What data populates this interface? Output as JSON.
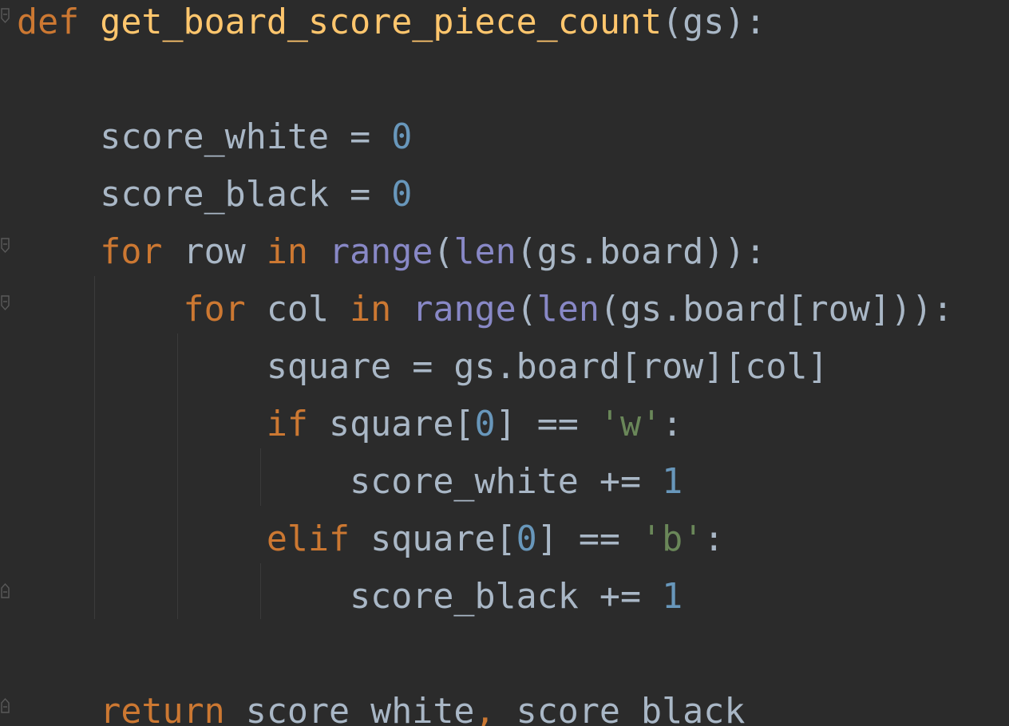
{
  "editor": {
    "background": "#2b2b2b",
    "colors": {
      "keyword": "#cc7832",
      "function_name": "#ffc66d",
      "builtin": "#8888c6",
      "number": "#6897bb",
      "string": "#6a8759",
      "identifier": "#a9b7c6"
    },
    "lines": [
      {
        "indent": "",
        "tokens": [
          {
            "t": "def",
            "c": "kw"
          },
          {
            "t": " ",
            "c": "plain"
          },
          {
            "t": "get_board_score_piece_count",
            "c": "fn"
          },
          {
            "t": "(gs):",
            "c": "punct"
          }
        ]
      },
      {
        "indent": "",
        "tokens": []
      },
      {
        "indent": "    ",
        "tokens": [
          {
            "t": "score_white",
            "c": "plain"
          },
          {
            "t": " = ",
            "c": "punct"
          },
          {
            "t": "0",
            "c": "num"
          }
        ]
      },
      {
        "indent": "    ",
        "tokens": [
          {
            "t": "score_black",
            "c": "plain"
          },
          {
            "t": " = ",
            "c": "punct"
          },
          {
            "t": "0",
            "c": "num"
          }
        ]
      },
      {
        "indent": "    ",
        "tokens": [
          {
            "t": "for",
            "c": "kw"
          },
          {
            "t": " row ",
            "c": "plain"
          },
          {
            "t": "in",
            "c": "kw"
          },
          {
            "t": " ",
            "c": "plain"
          },
          {
            "t": "range",
            "c": "bi"
          },
          {
            "t": "(",
            "c": "punct"
          },
          {
            "t": "len",
            "c": "bi"
          },
          {
            "t": "(gs.board)):",
            "c": "punct"
          }
        ]
      },
      {
        "indent": "        ",
        "tokens": [
          {
            "t": "for",
            "c": "kw"
          },
          {
            "t": " col ",
            "c": "plain"
          },
          {
            "t": "in",
            "c": "kw"
          },
          {
            "t": " ",
            "c": "plain"
          },
          {
            "t": "range",
            "c": "bi"
          },
          {
            "t": "(",
            "c": "punct"
          },
          {
            "t": "len",
            "c": "bi"
          },
          {
            "t": "(gs.board[row])):",
            "c": "punct"
          }
        ]
      },
      {
        "indent": "            ",
        "tokens": [
          {
            "t": "square = gs.board[row][col]",
            "c": "plain"
          }
        ]
      },
      {
        "indent": "            ",
        "tokens": [
          {
            "t": "if",
            "c": "kw"
          },
          {
            "t": " square[",
            "c": "plain"
          },
          {
            "t": "0",
            "c": "num"
          },
          {
            "t": "] == ",
            "c": "plain"
          },
          {
            "t": "'w'",
            "c": "str"
          },
          {
            "t": ":",
            "c": "punct"
          }
        ]
      },
      {
        "indent": "                ",
        "tokens": [
          {
            "t": "score_white += ",
            "c": "plain"
          },
          {
            "t": "1",
            "c": "num"
          }
        ]
      },
      {
        "indent": "            ",
        "tokens": [
          {
            "t": "elif",
            "c": "kw"
          },
          {
            "t": " square[",
            "c": "plain"
          },
          {
            "t": "0",
            "c": "num"
          },
          {
            "t": "] == ",
            "c": "plain"
          },
          {
            "t": "'b'",
            "c": "str"
          },
          {
            "t": ":",
            "c": "punct"
          }
        ]
      },
      {
        "indent": "                ",
        "tokens": [
          {
            "t": "score_black += ",
            "c": "plain"
          },
          {
            "t": "1",
            "c": "num"
          }
        ]
      },
      {
        "indent": "",
        "tokens": []
      },
      {
        "indent": "    ",
        "tokens": [
          {
            "t": "return",
            "c": "kw"
          },
          {
            "t": " score_white",
            "c": "plain"
          },
          {
            "t": ",",
            "c": "comma"
          },
          {
            "t": " score_black",
            "c": "plain"
          }
        ]
      }
    ],
    "fold_markers": [
      {
        "line": 0,
        "icon": "fold-open-icon"
      },
      {
        "line": 4,
        "icon": "fold-open-icon"
      },
      {
        "line": 5,
        "icon": "fold-open-icon"
      },
      {
        "line": 10,
        "icon": "fold-close-icon"
      },
      {
        "line": 12,
        "icon": "fold-close-icon"
      }
    ]
  }
}
